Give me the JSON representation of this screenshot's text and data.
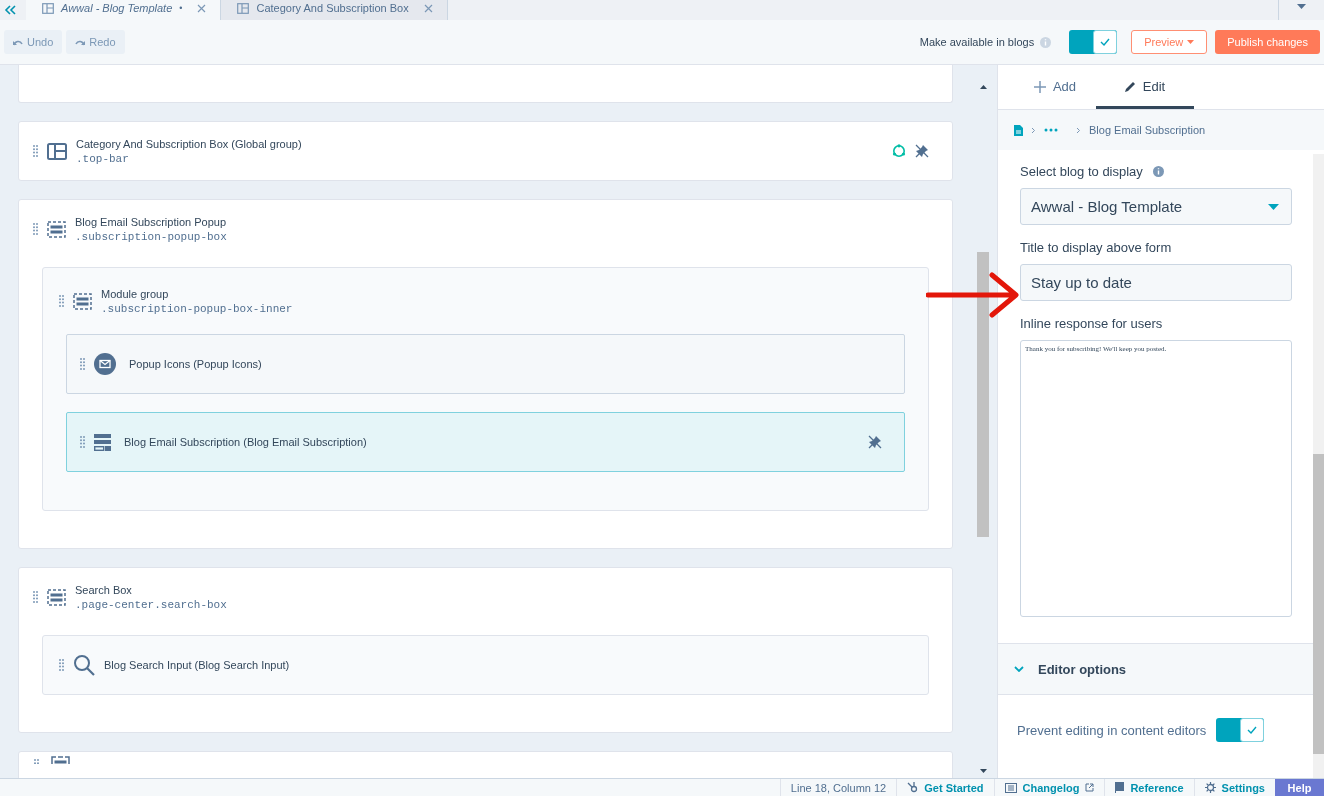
{
  "tabs": [
    {
      "label": "Awwal - Blog Template",
      "modified_mark": "•",
      "selected": true
    },
    {
      "label": "Category And Subscription Box",
      "selected": false
    }
  ],
  "toolbar": {
    "undo": {
      "label": "Undo",
      "disabled": true
    },
    "redo": {
      "label": "Redo",
      "disabled": true
    },
    "availability": {
      "label": "Make available in blogs",
      "on": true
    },
    "preview": "Preview",
    "publish": "Publish changes"
  },
  "canvas": {
    "items": [
      {
        "kind": "layout",
        "title": "Category And Subscription Box (Global group)",
        "selector": ".top-bar",
        "global": true,
        "locked": true
      },
      {
        "kind": "group",
        "title": "Blog Email Subscription Popup",
        "selector": ".subscription-popup-box",
        "global": false,
        "locked": false,
        "children": [
          {
            "kind": "group",
            "title": "Module group",
            "selector": ".subscription-popup-box-inner",
            "children": [
              {
                "kind": "email",
                "title": "Popup Icons (Popup Icons)",
                "selected": false,
                "locked": false
              },
              {
                "kind": "form",
                "title": "Blog Email Subscription (Blog Email Subscription)",
                "selected": true,
                "locked": true
              }
            ]
          }
        ]
      },
      {
        "kind": "group",
        "title": "Search Box",
        "selector": ".page-center.search-box",
        "global": false,
        "locked": false,
        "children": [
          {
            "kind": "search",
            "title": "Blog Search Input (Blog Search Input)"
          }
        ]
      }
    ]
  },
  "panel": {
    "tabs": [
      {
        "label": "Add",
        "selected": false
      },
      {
        "label": "Edit",
        "selected": true
      }
    ],
    "breadcrumb": {
      "current": "Blog Email Subscription"
    },
    "fields": [
      {
        "kind": "select",
        "label": "Select blog to display",
        "info": true,
        "value": "Awwal - Blog Template"
      },
      {
        "kind": "text",
        "label": "Title to display above form",
        "info": false,
        "value": "Stay up to date"
      },
      {
        "kind": "textarea",
        "label": "Inline response for users",
        "info": false,
        "value": "Thank you for subscribing! We'll keep you posted."
      }
    ],
    "section": {
      "title": "Editor options",
      "expanded": true
    },
    "options": [
      {
        "label": "Prevent editing in content editors",
        "on": true
      }
    ]
  },
  "status_bar": {
    "position": "Line 18, Column 12",
    "links": [
      {
        "kind": "start",
        "label": "Get Started",
        "external": false
      },
      {
        "kind": "changelog",
        "label": "Changelog",
        "external": true
      },
      {
        "kind": "reference",
        "label": "Reference",
        "external": false
      },
      {
        "kind": "settings",
        "label": "Settings",
        "external": false
      }
    ],
    "help": "Help"
  }
}
